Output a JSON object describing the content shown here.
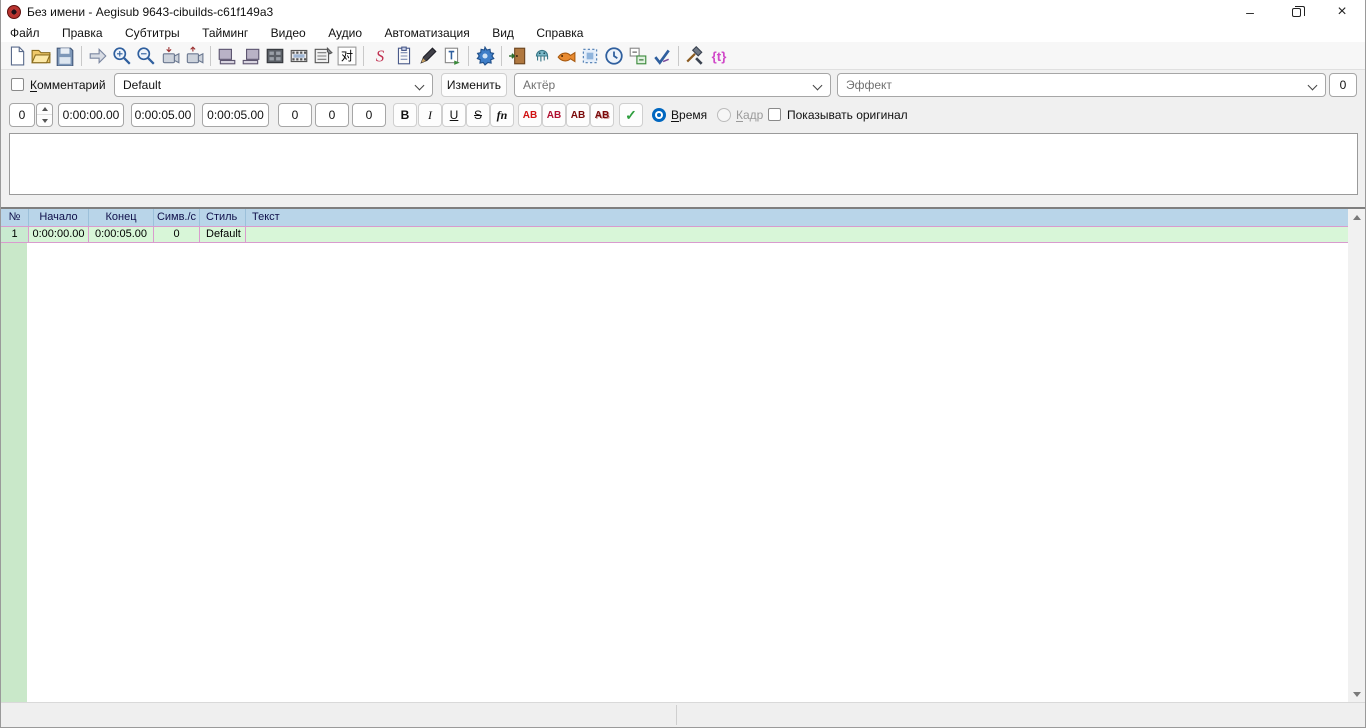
{
  "window": {
    "title": "Без имени - Aegisub 9643-cibuilds-c61f149a3",
    "minimize_glyph": "–",
    "close_glyph": "×"
  },
  "menu": {
    "items": [
      "Файл",
      "Правка",
      "Субтитры",
      "Тайминг",
      "Видео",
      "Аудио",
      "Автоматизация",
      "Вид",
      "Справка"
    ]
  },
  "toolbar": {
    "icons": [
      "new-file",
      "open-file",
      "save-file",
      "jump-arrow",
      "zoom-in",
      "zoom-out",
      "snap-start-to-video",
      "snap-end-to-video",
      "shift-start",
      "shift-end",
      "video-details",
      "film-strip",
      "storyboard",
      "kanji-timer",
      "styles-manager",
      "properties",
      "attachments",
      "fonts-collector",
      "automation",
      "resample-resolution",
      "visual-typesetting",
      "translation-assistant",
      "select-lines",
      "shift-times",
      "translate-assistant",
      "spell-checker",
      "configure",
      "karaoke-template"
    ],
    "styles_glyph": "S",
    "kanji_glyph": "对",
    "karaoke_glyph": "{t}"
  },
  "editor": {
    "comment_label": "Комментарий",
    "style_value": "Default",
    "edit_button_label": "Изменить",
    "actor_placeholder": "Актёр",
    "effect_placeholder": "Эффект",
    "right_counter_value": "0",
    "layer_value": "0",
    "start_time": "0:00:00.00",
    "end_time": "0:00:05.00",
    "duration": "0:00:05.00",
    "margin_left": "0",
    "margin_right": "0",
    "margin_vert": "0",
    "bold_label": "B",
    "italic_label": "I",
    "underline_label": "U",
    "strike_label": "S",
    "fn_label": "fn",
    "color1_label": "AB",
    "color2_label": "AB",
    "color3_label": "AB",
    "color4_label": "AB",
    "commit_glyph": "✓",
    "time_radio_label": "Время",
    "frame_radio_label": "Кадр",
    "show_original_label": "Показывать оригинал",
    "text_value": ""
  },
  "grid": {
    "columns": [
      "№",
      "Начало",
      "Конец",
      "Симв./с",
      "Стиль",
      "Текст"
    ],
    "rows": [
      {
        "n": "1",
        "start": "0:00:00.00",
        "end": "0:00:05.00",
        "cps": "0",
        "style": "Default",
        "text": ""
      }
    ]
  },
  "status": {
    "left": "",
    "right": ""
  },
  "colors": {
    "accent": "#0067c0",
    "grid_header_bg": "#b9d5e9",
    "active_row_bg": "#d8f6d8",
    "row_border": "#d99bce",
    "left_margin_bg": "#c9e8c9"
  }
}
